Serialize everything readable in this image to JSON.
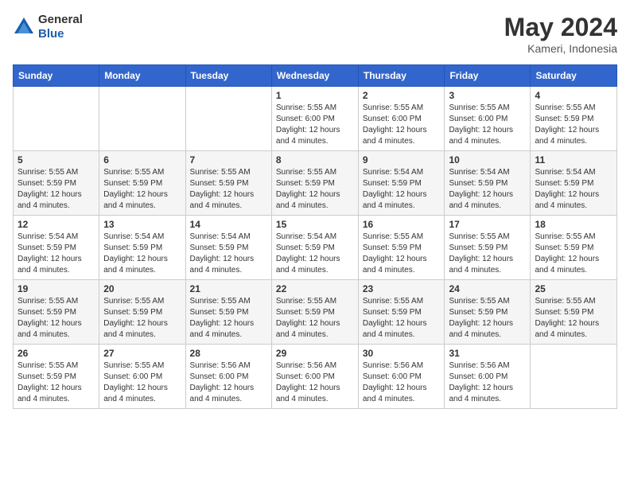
{
  "logo": {
    "general": "General",
    "blue": "Blue"
  },
  "title": {
    "month_year": "May 2024",
    "location": "Kameri, Indonesia"
  },
  "header_days": [
    "Sunday",
    "Monday",
    "Tuesday",
    "Wednesday",
    "Thursday",
    "Friday",
    "Saturday"
  ],
  "weeks": [
    [
      {
        "day": "",
        "info": ""
      },
      {
        "day": "",
        "info": ""
      },
      {
        "day": "",
        "info": ""
      },
      {
        "day": "1",
        "info": "Sunrise: 5:55 AM\nSunset: 6:00 PM\nDaylight: 12 hours\nand 4 minutes."
      },
      {
        "day": "2",
        "info": "Sunrise: 5:55 AM\nSunset: 6:00 PM\nDaylight: 12 hours\nand 4 minutes."
      },
      {
        "day": "3",
        "info": "Sunrise: 5:55 AM\nSunset: 6:00 PM\nDaylight: 12 hours\nand 4 minutes."
      },
      {
        "day": "4",
        "info": "Sunrise: 5:55 AM\nSunset: 5:59 PM\nDaylight: 12 hours\nand 4 minutes."
      }
    ],
    [
      {
        "day": "5",
        "info": "Sunrise: 5:55 AM\nSunset: 5:59 PM\nDaylight: 12 hours\nand 4 minutes."
      },
      {
        "day": "6",
        "info": "Sunrise: 5:55 AM\nSunset: 5:59 PM\nDaylight: 12 hours\nand 4 minutes."
      },
      {
        "day": "7",
        "info": "Sunrise: 5:55 AM\nSunset: 5:59 PM\nDaylight: 12 hours\nand 4 minutes."
      },
      {
        "day": "8",
        "info": "Sunrise: 5:55 AM\nSunset: 5:59 PM\nDaylight: 12 hours\nand 4 minutes."
      },
      {
        "day": "9",
        "info": "Sunrise: 5:54 AM\nSunset: 5:59 PM\nDaylight: 12 hours\nand 4 minutes."
      },
      {
        "day": "10",
        "info": "Sunrise: 5:54 AM\nSunset: 5:59 PM\nDaylight: 12 hours\nand 4 minutes."
      },
      {
        "day": "11",
        "info": "Sunrise: 5:54 AM\nSunset: 5:59 PM\nDaylight: 12 hours\nand 4 minutes."
      }
    ],
    [
      {
        "day": "12",
        "info": "Sunrise: 5:54 AM\nSunset: 5:59 PM\nDaylight: 12 hours\nand 4 minutes."
      },
      {
        "day": "13",
        "info": "Sunrise: 5:54 AM\nSunset: 5:59 PM\nDaylight: 12 hours\nand 4 minutes."
      },
      {
        "day": "14",
        "info": "Sunrise: 5:54 AM\nSunset: 5:59 PM\nDaylight: 12 hours\nand 4 minutes."
      },
      {
        "day": "15",
        "info": "Sunrise: 5:54 AM\nSunset: 5:59 PM\nDaylight: 12 hours\nand 4 minutes."
      },
      {
        "day": "16",
        "info": "Sunrise: 5:55 AM\nSunset: 5:59 PM\nDaylight: 12 hours\nand 4 minutes."
      },
      {
        "day": "17",
        "info": "Sunrise: 5:55 AM\nSunset: 5:59 PM\nDaylight: 12 hours\nand 4 minutes."
      },
      {
        "day": "18",
        "info": "Sunrise: 5:55 AM\nSunset: 5:59 PM\nDaylight: 12 hours\nand 4 minutes."
      }
    ],
    [
      {
        "day": "19",
        "info": "Sunrise: 5:55 AM\nSunset: 5:59 PM\nDaylight: 12 hours\nand 4 minutes."
      },
      {
        "day": "20",
        "info": "Sunrise: 5:55 AM\nSunset: 5:59 PM\nDaylight: 12 hours\nand 4 minutes."
      },
      {
        "day": "21",
        "info": "Sunrise: 5:55 AM\nSunset: 5:59 PM\nDaylight: 12 hours\nand 4 minutes."
      },
      {
        "day": "22",
        "info": "Sunrise: 5:55 AM\nSunset: 5:59 PM\nDaylight: 12 hours\nand 4 minutes."
      },
      {
        "day": "23",
        "info": "Sunrise: 5:55 AM\nSunset: 5:59 PM\nDaylight: 12 hours\nand 4 minutes."
      },
      {
        "day": "24",
        "info": "Sunrise: 5:55 AM\nSunset: 5:59 PM\nDaylight: 12 hours\nand 4 minutes."
      },
      {
        "day": "25",
        "info": "Sunrise: 5:55 AM\nSunset: 5:59 PM\nDaylight: 12 hours\nand 4 minutes."
      }
    ],
    [
      {
        "day": "26",
        "info": "Sunrise: 5:55 AM\nSunset: 5:59 PM\nDaylight: 12 hours\nand 4 minutes."
      },
      {
        "day": "27",
        "info": "Sunrise: 5:55 AM\nSunset: 6:00 PM\nDaylight: 12 hours\nand 4 minutes."
      },
      {
        "day": "28",
        "info": "Sunrise: 5:56 AM\nSunset: 6:00 PM\nDaylight: 12 hours\nand 4 minutes."
      },
      {
        "day": "29",
        "info": "Sunrise: 5:56 AM\nSunset: 6:00 PM\nDaylight: 12 hours\nand 4 minutes."
      },
      {
        "day": "30",
        "info": "Sunrise: 5:56 AM\nSunset: 6:00 PM\nDaylight: 12 hours\nand 4 minutes."
      },
      {
        "day": "31",
        "info": "Sunrise: 5:56 AM\nSunset: 6:00 PM\nDaylight: 12 hours\nand 4 minutes."
      },
      {
        "day": "",
        "info": ""
      }
    ]
  ]
}
